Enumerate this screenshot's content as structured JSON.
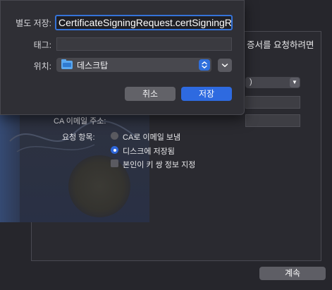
{
  "background": {
    "intro_fragment": "증서를 요청하려면",
    "ca_email_label": "CA 이메일 주소:",
    "request_label": "요청 항목:",
    "options": [
      {
        "label": "CA로 이메일 보냄",
        "selected": false
      },
      {
        "label": "디스크에 저장됨",
        "selected": true
      }
    ],
    "key_pair_checkbox": {
      "label": "본인이 키 쌍 정보 지정",
      "checked": false
    },
    "select_value": ")",
    "continue_label": "계속"
  },
  "save_sheet": {
    "save_as_label": "별도 저장:",
    "filename": "CertificateSigningRequest.certSigningRequest",
    "tags_label": "태그:",
    "tags_value": "",
    "where_label": "위치:",
    "where_value": "데스크탑",
    "cancel_label": "취소",
    "save_label": "저장"
  },
  "colors": {
    "accent": "#2e6ae0",
    "focus_ring": "#3573d9",
    "sheet_bg": "#2f2f35",
    "window_bg": "#26262c"
  },
  "icons": {
    "folder": "folder-icon",
    "updown": "updown-chevron-icon",
    "expand": "chevron-down-icon"
  }
}
